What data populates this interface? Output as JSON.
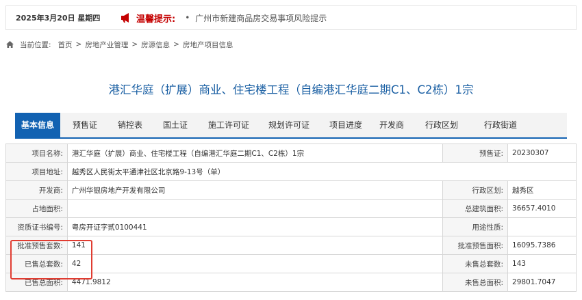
{
  "notice": {
    "date": "2025年3月20日 星期四",
    "tip_title": "温馨提示:",
    "bullet": "•",
    "tip_text": "广州市新建商品房交易事项风险提示",
    "accent": "#c40000"
  },
  "breadcrumb": {
    "prefix": "当前位置:",
    "items": [
      "首页",
      "房地产业管理",
      "房源信息",
      "房地产项目信息"
    ],
    "separator": ">"
  },
  "page_title": "港汇华庭（扩展）商业、住宅楼工程（自编港汇华庭二期C1、C2栋）1宗",
  "tabs": [
    {
      "label": "基本信息",
      "active": true
    },
    {
      "label": "预售证"
    },
    {
      "label": "销控表"
    },
    {
      "label": "国土证"
    },
    {
      "label": "施工许可证"
    },
    {
      "label": "规划许可证"
    },
    {
      "label": "项目进度"
    },
    {
      "label": "开发商"
    },
    {
      "label": "行政区划"
    },
    {
      "label": "行政街道"
    }
  ],
  "fields": {
    "project_name_label": "项目名称:",
    "project_name": "港汇华庭（扩展）商业、住宅楼工程（自编港汇华庭二期C1、C2栋）1宗",
    "presale_label": "预售证:",
    "presale": "20230307",
    "address_label": "项目地址:",
    "address": "越秀区人民街太平通津社区北京路9-13号（单）",
    "developer_label": "开发商:",
    "developer": "广州华银房地产开发有限公司",
    "district_label": "行政区划:",
    "district": "越秀区",
    "land_area_label": "占地面积:",
    "land_area": "",
    "total_build_label": "总建筑面积:",
    "total_build": "36657.4010",
    "cert_label": "资质证书编号:",
    "cert": "粤房开证字贰0100441",
    "usage_label": "用途性质:",
    "usage": "",
    "approved_units_label": "批准预售套数:",
    "approved_units": "141",
    "approved_area_label": "批准预售面积:",
    "approved_area": "16095.7386",
    "sold_units_label": "已售总套数:",
    "sold_units": "42",
    "unsold_units_label": "未售总套数:",
    "unsold_units": "143",
    "sold_area_label": "已售总面积:",
    "sold_area": "4471.9812",
    "unsold_area_label": "未售总面积:",
    "unsold_area": "29801.7047"
  }
}
